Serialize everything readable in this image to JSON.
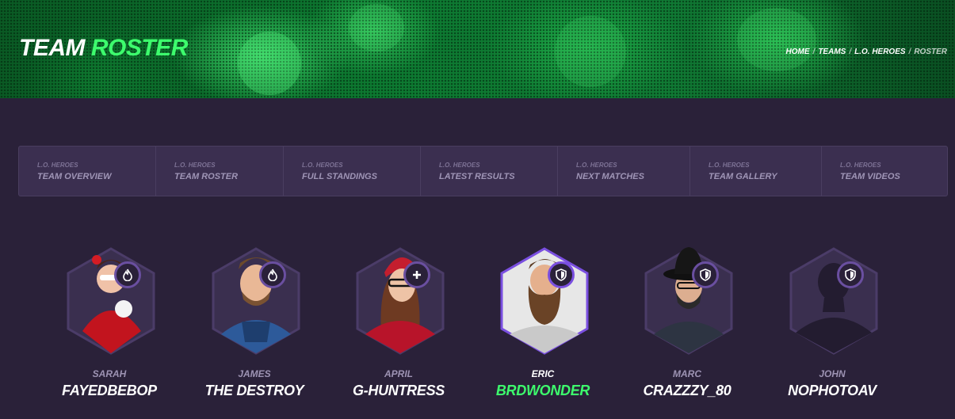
{
  "hero": {
    "title_main": "TEAM",
    "title_accent": "ROSTER",
    "breadcrumb": [
      "HOME",
      "TEAMS",
      "L.O. HEROES",
      "ROSTER"
    ]
  },
  "subnav": [
    {
      "kicker": "L.O. HEROES",
      "label": "TEAM OVERVIEW"
    },
    {
      "kicker": "L.O. HEROES",
      "label": "TEAM ROSTER"
    },
    {
      "kicker": "L.O. HEROES",
      "label": "FULL STANDINGS"
    },
    {
      "kicker": "L.O. HEROES",
      "label": "LATEST RESULTS"
    },
    {
      "kicker": "L.O. HEROES",
      "label": "NEXT MATCHES"
    },
    {
      "kicker": "L.O. HEROES",
      "label": "TEAM GALLERY"
    },
    {
      "kicker": "L.O. HEROES",
      "label": "TEAM VIDEOS"
    }
  ],
  "players": [
    {
      "first_name": "SARAH",
      "nickname": "FAYEDBEBOP",
      "role_icon": "flame-icon"
    },
    {
      "first_name": "JAMES",
      "nickname": "THE DESTROY",
      "role_icon": "flame-icon"
    },
    {
      "first_name": "APRIL",
      "nickname": "G-HUNTRESS",
      "role_icon": "plus-icon"
    },
    {
      "first_name": "ERIC",
      "nickname": "BRDWONDER",
      "role_icon": "shield-icon"
    },
    {
      "first_name": "MARC",
      "nickname": "CRAZZZY_80",
      "role_icon": "shield-icon"
    },
    {
      "first_name": "JOHN",
      "nickname": "NOPHOTOAV",
      "role_icon": "shield-icon"
    }
  ],
  "colors": {
    "background": "#2a2139",
    "accent_green": "#3dfc6d",
    "hex_border": "#4b3c68",
    "hex_border_active": "#7a4fe0"
  }
}
